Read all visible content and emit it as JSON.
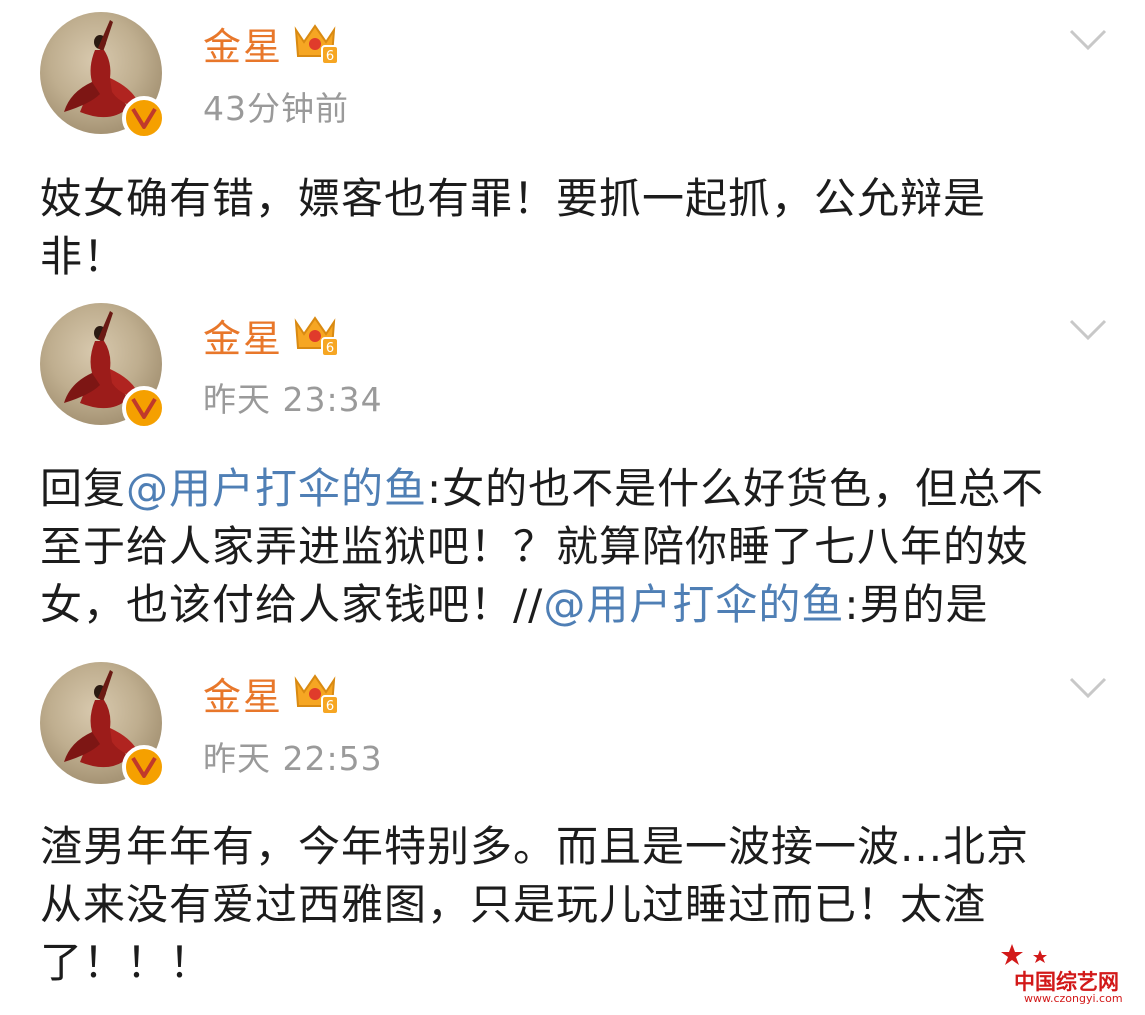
{
  "posts": [
    {
      "author": "金星",
      "time": "43分钟前",
      "text_lines": [
        "妓女确有错，嫖客也有罪！要抓一起抓，公允辩是",
        "非！"
      ]
    },
    {
      "author": "金星",
      "time": "昨天 23:34",
      "reply_prefix": "回复",
      "mention1": "@用户打伞的鱼",
      "line1_rest": ":女的也不是什么好货色，但总不",
      "line2": "至于给人家弄进监狱吧！？就算陪你睡了七八年的妓",
      "line3_start": "女，也该付给人家钱吧！//",
      "mention2": "@用户打伞的鱼",
      "line3_end": ":男的是"
    },
    {
      "author": "金星",
      "time": "昨天 22:53",
      "text_lines": [
        "渣男年年有，今年特别多。而且是一波接一波...北京",
        "从来没有爱过西雅图，只是玩儿过睡过而已！太渣",
        "了！！！"
      ]
    }
  ],
  "icons": {
    "verified": "verified-v-badge",
    "vip_crown": "vip-crown-level-6",
    "chevron": "chevron-down"
  },
  "colors": {
    "author_name": "#e8772a",
    "mention": "#4f7fb5",
    "timestamp": "#9a9a9a",
    "verified_badge": "#f5a000",
    "watermark": "#d21919"
  },
  "watermark": {
    "title": "中国综艺网",
    "url": "www.czongyi.com"
  }
}
